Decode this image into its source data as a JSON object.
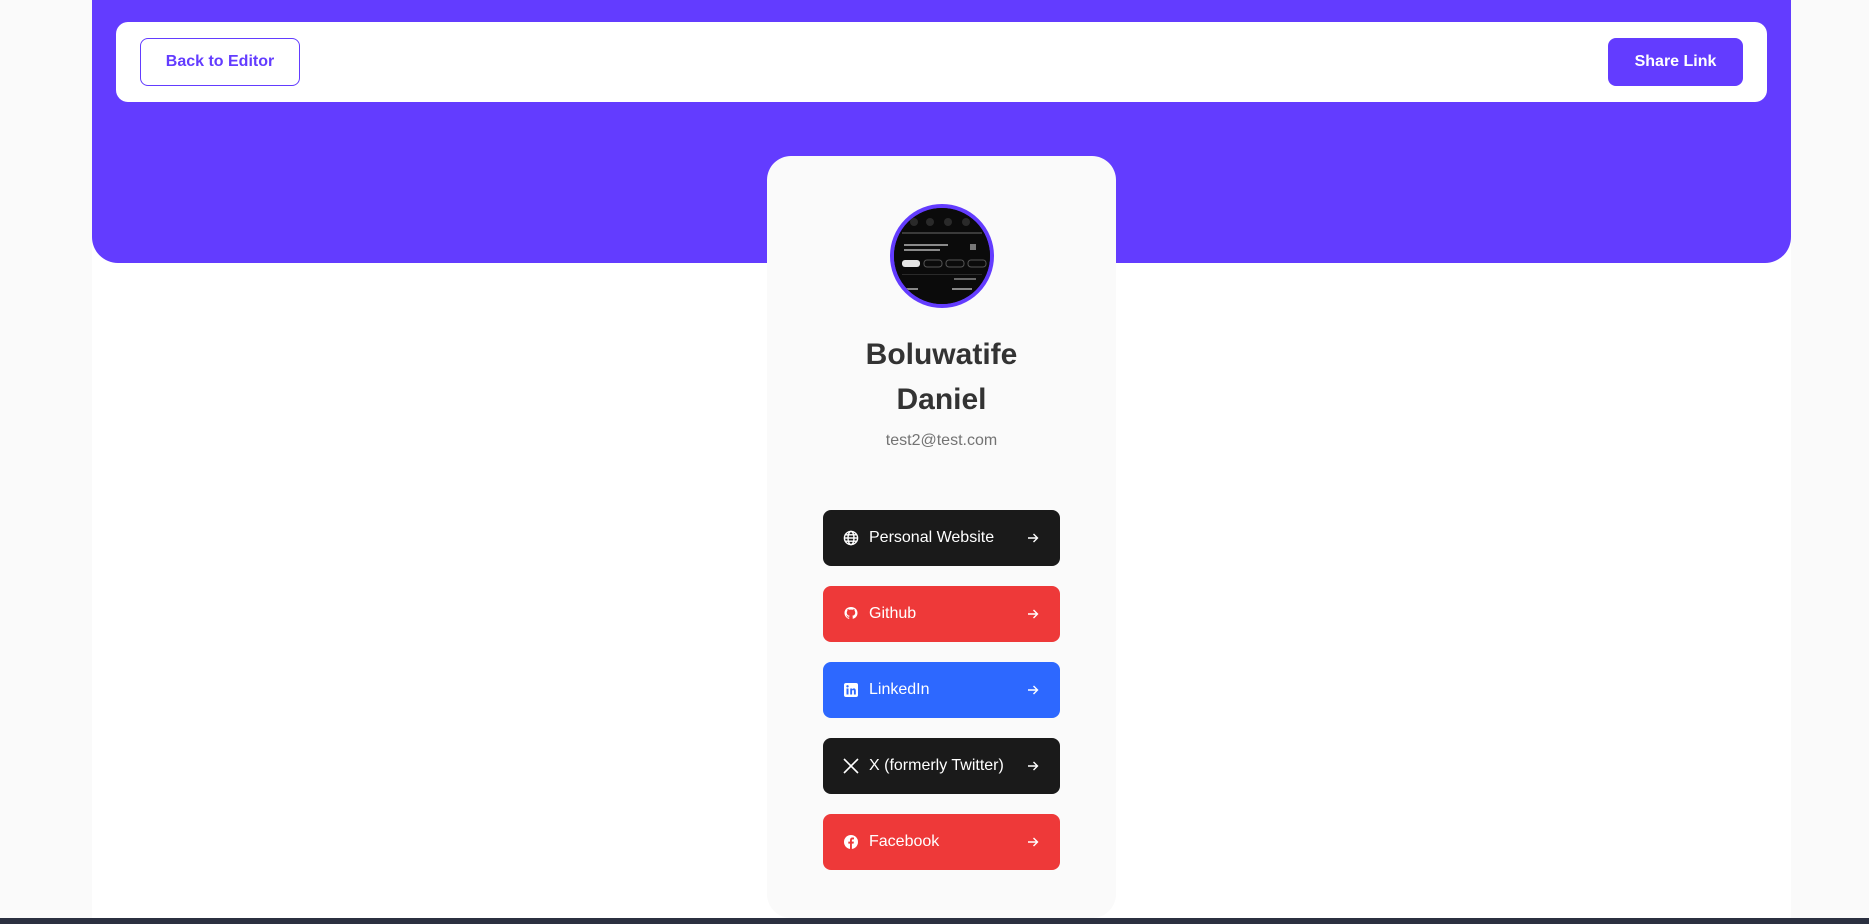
{
  "navbar": {
    "back_label": "Back to Editor",
    "share_label": "Share Link"
  },
  "profile": {
    "first_name": "Boluwatife",
    "last_name": "Daniel",
    "email": "test2@test.com"
  },
  "links": [
    {
      "label": "Personal Website",
      "icon": "globe-icon",
      "color": "#1a1a1a"
    },
    {
      "label": "Github",
      "icon": "github-icon",
      "color": "#ee3939"
    },
    {
      "label": "LinkedIn",
      "icon": "linkedin-icon",
      "color": "#2d68ff"
    },
    {
      "label": "X (formerly Twitter)",
      "icon": "x-icon",
      "color": "#1a1a1a"
    },
    {
      "label": "Facebook",
      "icon": "facebook-icon",
      "color": "#ee3939"
    }
  ],
  "colors": {
    "accent": "#633cff",
    "text_dark": "#333333",
    "text_muted": "#737373"
  }
}
